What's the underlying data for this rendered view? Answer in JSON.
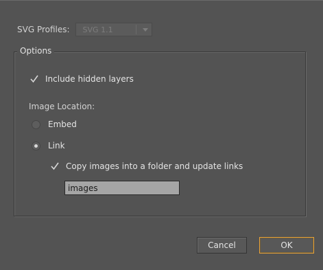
{
  "svg_profiles": {
    "label": "SVG Profiles:",
    "selected_value": "SVG 1.1"
  },
  "options": {
    "legend": "Options",
    "include_hidden_layers": {
      "label": "Include hidden layers",
      "checked": true
    },
    "image_location": {
      "label": "Image Location:",
      "embed_label": "Embed",
      "link_label": "Link",
      "selected": "Link"
    },
    "copy_images": {
      "label": "Copy images into a folder and update links",
      "checked": true
    },
    "folder_name": {
      "value": "images"
    }
  },
  "buttons": {
    "cancel_label": "Cancel",
    "ok_label": "OK"
  },
  "colors": {
    "dialog_background": "#535353",
    "ok_focus_border": "#e8a33a",
    "input_background": "#a5a5a5"
  }
}
